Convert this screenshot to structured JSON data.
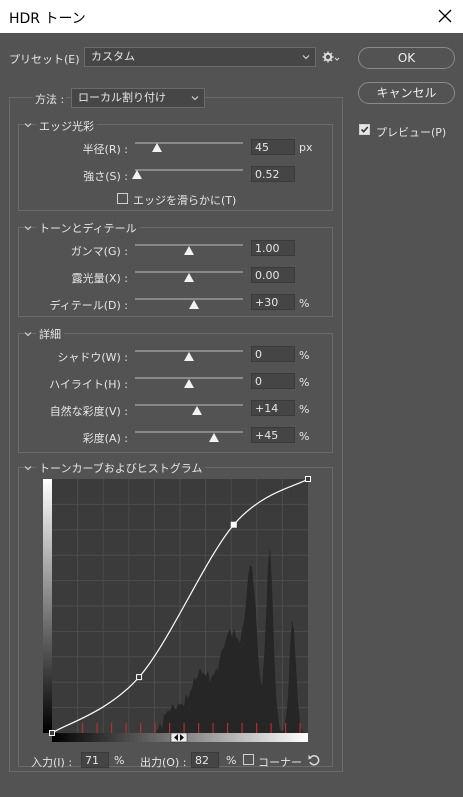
{
  "window": {
    "title": "HDR トーン"
  },
  "preset": {
    "label": "プリセット(E) :",
    "value": "カスタム"
  },
  "method": {
    "label": "方法 :",
    "value": "ローカル割り付け"
  },
  "buttons": {
    "ok": "OK",
    "cancel": "キャンセル"
  },
  "preview": {
    "label": "プレビュー(P)",
    "checked": true
  },
  "edge_glow": {
    "title": "エッジ光彩",
    "radius": {
      "label": "半径(R) :",
      "value": "45",
      "unit": "px",
      "level": 0.2
    },
    "strength": {
      "label": "強さ(S) :",
      "value": "0.52",
      "level": 0.02
    },
    "smooth_edges": {
      "label": "エッジを滑らかに(T)",
      "checked": false
    }
  },
  "tone_detail": {
    "title": "トーンとディテール",
    "gamma": {
      "label": "ガンマ(G) :",
      "value": "1.00",
      "level": 0.5
    },
    "exposure": {
      "label": "露光量(X) :",
      "value": "0.00",
      "level": 0.5
    },
    "detail": {
      "label": "ディテール(D) :",
      "value": "+30",
      "unit": "%",
      "level": 0.55
    }
  },
  "advanced": {
    "title": "詳細",
    "shadow": {
      "label": "シャドウ(W) :",
      "value": "0",
      "unit": "%",
      "level": 0.5
    },
    "highlight": {
      "label": "ハイライト(H) :",
      "value": "0",
      "unit": "%",
      "level": 0.5
    },
    "vibrance": {
      "label": "自然な彩度(V) :",
      "value": "+14",
      "unit": "%",
      "level": 0.57
    },
    "saturation": {
      "label": "彩度(A) :",
      "value": "+45",
      "unit": "%",
      "level": 0.73
    }
  },
  "curve": {
    "title": "トーンカーブおよびヒストグラム",
    "input_label": "入力(I) :",
    "input_value": "71",
    "input_unit": "%",
    "output_label": "出力(O) :",
    "output_value": "82",
    "output_unit": "%",
    "corner_label": "コーナー",
    "points": [
      [
        0,
        0
      ],
      [
        0.34,
        0.22
      ],
      [
        0.71,
        0.82
      ],
      [
        1,
        1
      ]
    ]
  }
}
